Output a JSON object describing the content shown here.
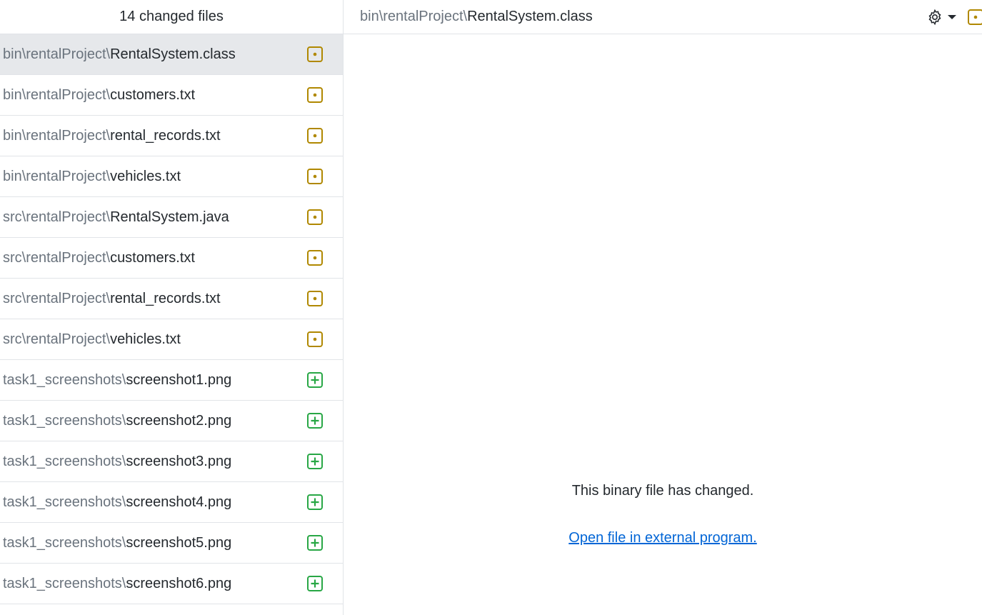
{
  "sidebar": {
    "header": "14 changed files",
    "files": [
      {
        "dir": "bin\\rentalProject\\",
        "name": "RentalSystem.class",
        "status": "modified",
        "selected": true
      },
      {
        "dir": "bin\\rentalProject\\",
        "name": "customers.txt",
        "status": "modified"
      },
      {
        "dir": "bin\\rentalProject\\",
        "name": "rental_records.txt",
        "status": "modified"
      },
      {
        "dir": "bin\\rentalProject\\",
        "name": "vehicles.txt",
        "status": "modified"
      },
      {
        "dir": "src\\rentalProject\\",
        "name": "RentalSystem.java",
        "status": "modified"
      },
      {
        "dir": "src\\rentalProject\\",
        "name": "customers.txt",
        "status": "modified"
      },
      {
        "dir": "src\\rentalProject\\",
        "name": "rental_records.txt",
        "status": "modified"
      },
      {
        "dir": "src\\rentalProject\\",
        "name": "vehicles.txt",
        "status": "modified"
      },
      {
        "dir": "task1_screenshots\\",
        "name": "screenshot1.png",
        "status": "added"
      },
      {
        "dir": "task1_screenshots\\",
        "name": "screenshot2.png",
        "status": "added"
      },
      {
        "dir": "task1_screenshots\\",
        "name": "screenshot3.png",
        "status": "added"
      },
      {
        "dir": "task1_screenshots\\",
        "name": "screenshot4.png",
        "status": "added"
      },
      {
        "dir": "task1_screenshots\\",
        "name": "screenshot5.png",
        "status": "added"
      },
      {
        "dir": "task1_screenshots\\",
        "name": "screenshot6.png",
        "status": "added"
      }
    ]
  },
  "diff": {
    "path_dir": "bin\\rentalProject\\",
    "path_name": "RentalSystem.class",
    "message": "This binary file has changed.",
    "link": "Open file in external program."
  },
  "icons": {
    "settings": "gear-icon",
    "modified": "file-modified-icon",
    "added": "file-added-icon"
  },
  "colors": {
    "modified": "#b08800",
    "added": "#28a745",
    "link": "#0366d6",
    "selected_row": "#e6e8eb"
  }
}
